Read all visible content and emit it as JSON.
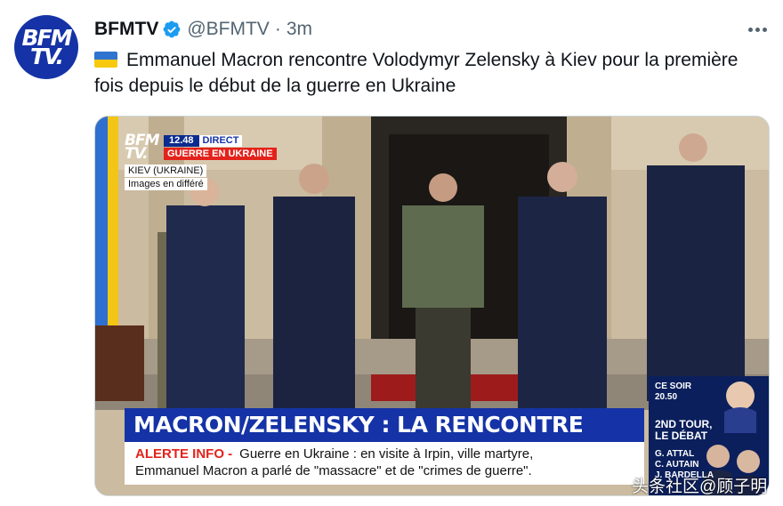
{
  "tweet": {
    "author_name": "BFMTV",
    "handle": "@BFMTV",
    "separator": "·",
    "time": "3m",
    "text": "Emmanuel Macron rencontre Volodymyr Zelensky à Kiev pour la première fois depuis le début de la guerre en Ukraine",
    "avatar_text": "BFM TV."
  },
  "video": {
    "channel_logo": "BFM TV.",
    "clock": "12.48",
    "direct": "DIRECT",
    "topic": "GUERRE EN UKRAINE",
    "location": "KIEV (UKRAINE)",
    "images_note": "Images en différé",
    "headline": "MACRON/ZELENSKY : LA RENCONTRE",
    "alert_label": "ALERTE INFO -",
    "alert_line1": "Guerre en Ukraine : en visite à Irpin, ville martyre,",
    "alert_line2": "Emmanuel Macron a parlé de \"massacre\" et de \"crimes de guerre\".",
    "promo": {
      "ce_soir": "CE SOIR",
      "promo_time": "20.50",
      "tour_line1": "2ND TOUR,",
      "tour_line2": "LE DÉBAT",
      "guest1": "G. ATTAL",
      "guest2": "C. AUTAIN",
      "guest3": "J. BARDELLA"
    }
  },
  "watermark": "头条社区@顾子明",
  "colors": {
    "brand_blue": "#1533a6",
    "alert_red": "#e3231b",
    "verified_blue": "#1d9bf0",
    "muted_text": "#536471"
  },
  "icons": [
    "verified-icon",
    "more-icon",
    "ukraine-flag-icon"
  ]
}
